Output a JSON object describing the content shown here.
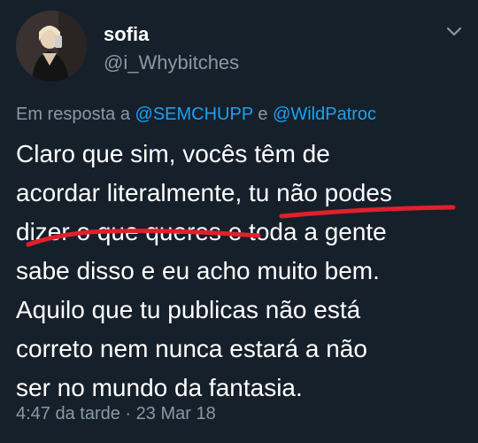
{
  "author": {
    "name": "sofia",
    "handle": "@i_Whybitches",
    "avatar_icon": "profile-photo"
  },
  "reply": {
    "prefix": "Em resposta a",
    "mention_1": "@SEMCHUPP",
    "conjunction": "e",
    "mention_2": "@WildPatroc"
  },
  "text_lines": [
    "Claro que sim, vocês têm de",
    "acordar literalmente, tu não podes",
    "dizer o que queres e toda a gente",
    "sabe disso e eu acho muito bem.",
    "Aquilo que tu publicas não está",
    "correto nem nunca estará a não",
    "ser no mundo da fantasia."
  ],
  "timestamp": "4:47 da tarde · 23 Mar 18",
  "colors": {
    "background": "#16202b",
    "text": "#ffffff",
    "secondary": "#8899a6",
    "mention": "#1da1f2",
    "underline": "#e0202a"
  },
  "menu_icon": "chevron-down-icon"
}
